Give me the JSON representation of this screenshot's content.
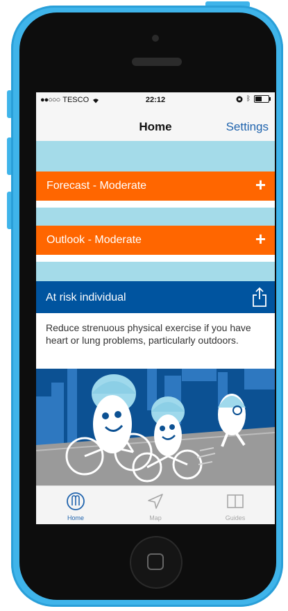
{
  "status_bar": {
    "carrier": "TESCO",
    "time": "22:12"
  },
  "nav": {
    "title": "Home",
    "settings_label": "Settings"
  },
  "forecast": {
    "label": "Forecast - Moderate",
    "expand_symbol": "+"
  },
  "outlook": {
    "label": "Outlook - Moderate",
    "expand_symbol": "+"
  },
  "risk": {
    "title": "At risk individual",
    "advice": "Reduce strenuous physical exercise if you have heart or lung problems, particularly outdoors."
  },
  "tabs": [
    {
      "label": "Home",
      "icon": "home-icon",
      "active": true
    },
    {
      "label": "Map",
      "icon": "location-arrow-icon",
      "active": false
    },
    {
      "label": "Guides",
      "icon": "book-icon",
      "active": false
    }
  ],
  "colors": {
    "accent_orange": "#ff6600",
    "header_blue": "#00549f",
    "sky_blue": "#a4dbe9",
    "link_blue": "#1f63ad",
    "phone_case": "#3fb4ea"
  }
}
